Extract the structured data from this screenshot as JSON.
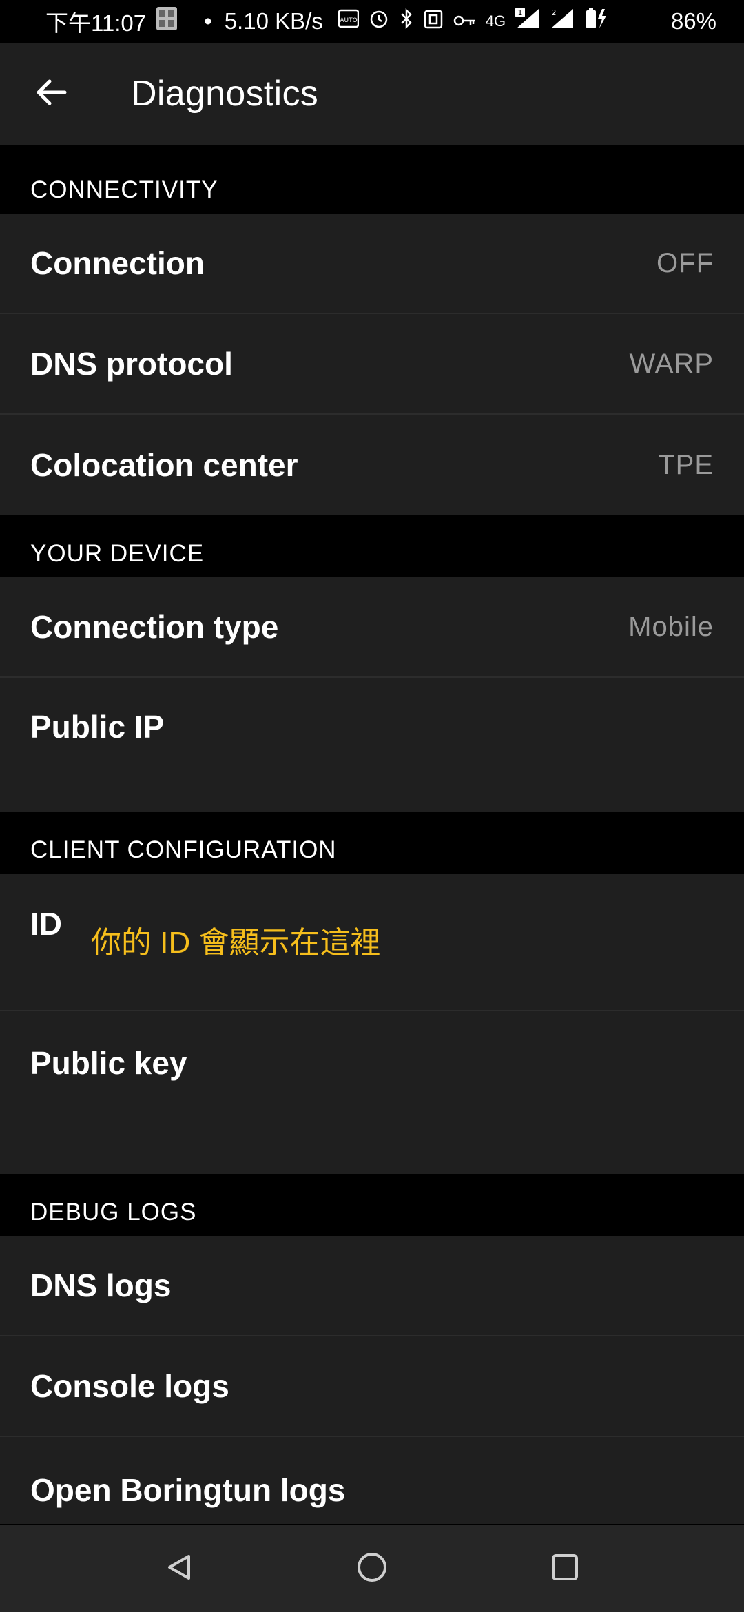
{
  "status_bar": {
    "time": "下午11:07",
    "dot": "•",
    "speed": "5.10 KB/s",
    "network": "4G",
    "battery": "86%"
  },
  "app_bar": {
    "title": "Diagnostics",
    "back_icon": "arrow-left-icon"
  },
  "sections": {
    "connectivity": {
      "header": "CONNECTIVITY",
      "rows": [
        {
          "label": "Connection",
          "value": "OFF"
        },
        {
          "label": "DNS protocol",
          "value": "WARP"
        },
        {
          "label": "Colocation center",
          "value": "TPE"
        }
      ]
    },
    "device": {
      "header": "YOUR DEVICE",
      "rows": [
        {
          "label": "Connection type",
          "value": "Mobile"
        },
        {
          "label": "Public IP",
          "value": ""
        }
      ]
    },
    "client": {
      "header": "CLIENT CONFIGURATION",
      "id_label": "ID",
      "id_note": "你的 ID 會顯示在這裡",
      "public_key_label": "Public key"
    },
    "debug": {
      "header": "DEBUG LOGS",
      "rows": [
        {
          "label": "DNS logs"
        },
        {
          "label": "Console logs"
        },
        {
          "label": "Open Boringtun logs"
        }
      ]
    }
  },
  "colors": {
    "background": "#000000",
    "surface": "#1f1f1f",
    "accent_note": "#f6be1c",
    "secondary_text": "#9a9a9a"
  },
  "nav_bar": {
    "icons": [
      "back-triangle-icon",
      "home-circle-icon",
      "recents-square-icon"
    ]
  }
}
